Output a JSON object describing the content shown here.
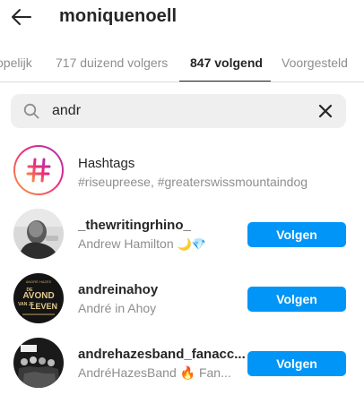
{
  "header": {
    "title": "moniquenoell"
  },
  "tabs": [
    {
      "label": "opelijk"
    },
    {
      "label": "717 duizend volgers"
    },
    {
      "label": "847 volgend"
    },
    {
      "label": "Voorgesteld"
    }
  ],
  "search": {
    "value": "andr"
  },
  "hashtag_result": {
    "title": "Hashtags",
    "subtitle": "#riseupreese, #greaterswissmountaindog"
  },
  "results": [
    {
      "username": "_thewritingrhino_",
      "fullname": "Andrew Hamilton",
      "emoji": "🌙💎",
      "button": "Volgen",
      "avatar_image": "man-portrait-grayscale"
    },
    {
      "username": "andreinahoy",
      "fullname": "André in Ahoy",
      "emoji": "",
      "button": "Volgen",
      "avatar_image": "avond-van-je-leven-poster",
      "avatar_text": {
        "top": "ANDRÉ HAZES",
        "line1": "DE",
        "line2": "AVOND",
        "line3": "VAN JE",
        "line4": "LEVEN"
      }
    },
    {
      "username": "andrehazesband_fanacc...",
      "fullname": "AndréHazesBand 🔥 Fan...",
      "emoji": "",
      "button": "Volgen",
      "avatar_image": "band-group-photo"
    }
  ],
  "colors": {
    "primary_button": "#0095f6",
    "text": "#262626",
    "secondary_text": "#8e8e8e",
    "search_bg": "#efefef"
  }
}
